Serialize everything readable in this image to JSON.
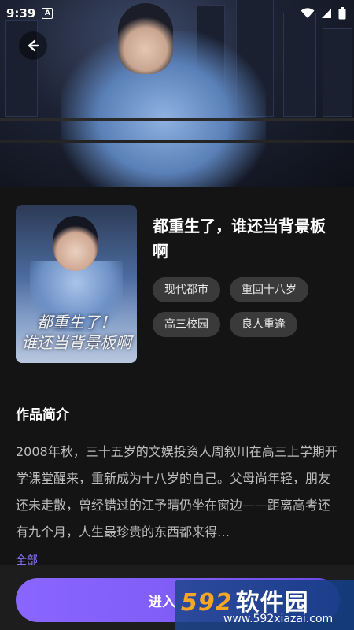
{
  "status_bar": {
    "time": "9:39",
    "notification_icon": "A"
  },
  "book": {
    "title": "都重生了，谁还当背景板啊",
    "cover_title_line1": "都重生了！",
    "cover_title_line2": "谁还当背景板啊",
    "tags": [
      "现代都市",
      "重回十八岁",
      "高三校园",
      "良人重逢"
    ]
  },
  "synopsis": {
    "heading": "作品简介",
    "text": "2008年秋，三十五岁的文娱投资人周叙川在高三上学期开学课堂醒来，重新成为十八岁的自己。父母尚年轻，朋友还未走散，曾经错过的江予晴仍坐在窗边——距离高考还有九个月，人生最珍贵的东西都来得…",
    "expand_label": "全部"
  },
  "action": {
    "enter_label": "进入"
  },
  "watermark": {
    "digits": "592",
    "cn": "软件园",
    "url": "www.592xiazai.com"
  },
  "colors": {
    "background": "#141414",
    "accent": "#8a65ff",
    "tag_bg": "#3a3a3a"
  }
}
